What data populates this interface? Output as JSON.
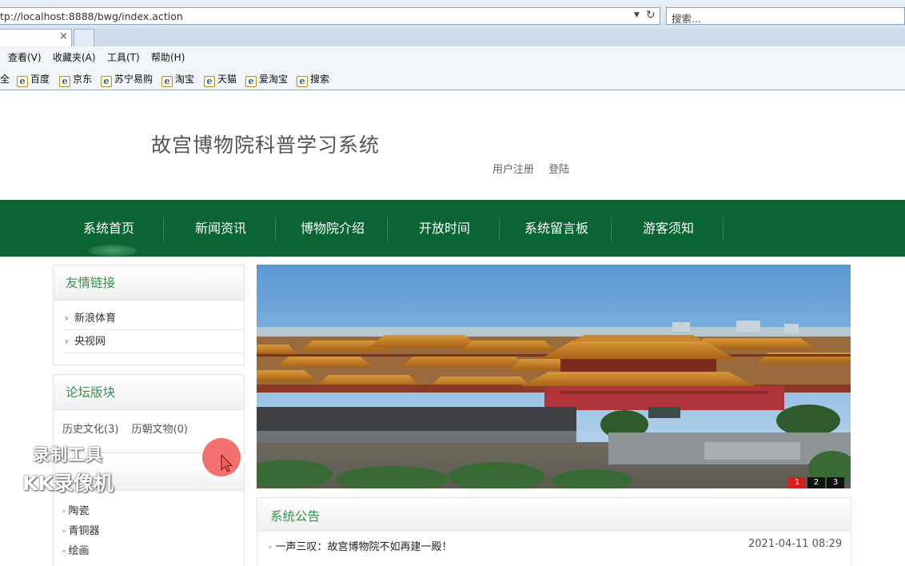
{
  "browser": {
    "address": "tp://localhost:8888/bwg/index.action",
    "search_placeholder": "搜索...",
    "tab_close": "×",
    "menu": [
      "查看(V)",
      "收藏夹(A)",
      "工具(T)",
      "帮助(H)"
    ],
    "favorites_partial": "全",
    "favorites": [
      "百度",
      "京东",
      "苏宁易购",
      "淘宝",
      "天猫",
      "爱淘宝",
      "搜索"
    ]
  },
  "site": {
    "title": "故宫博物院科普学习系统",
    "register": "用户注册",
    "login": "登陆"
  },
  "nav": [
    "系统首页",
    "新闻资讯",
    "博物院介绍",
    "开放时间",
    "系统留言板",
    "游客须知"
  ],
  "sidebar": {
    "links_title": "友情链接",
    "links": [
      "新浪体育",
      "央视网"
    ],
    "forum_title": "论坛版块",
    "forums": [
      "历史文化(3)",
      "历朝文物(0)"
    ],
    "categories": [
      "陶瓷",
      "青铜器",
      "绘画"
    ]
  },
  "banner": {
    "pages": [
      "1",
      "2",
      "3"
    ],
    "active_page": "1"
  },
  "notice": {
    "title": "系统公告",
    "items": [
      {
        "title": "一声三叹：故宫博物院不如再建一殿！",
        "date": "2021-04-11 08:29"
      }
    ]
  },
  "overlay": {
    "watermark_line1": "录制工具",
    "watermark_line2": "KK录像机"
  },
  "colors": {
    "nav_green": "#0a6434",
    "title_green": "#3a8e51",
    "pager_active": "#d42020"
  }
}
